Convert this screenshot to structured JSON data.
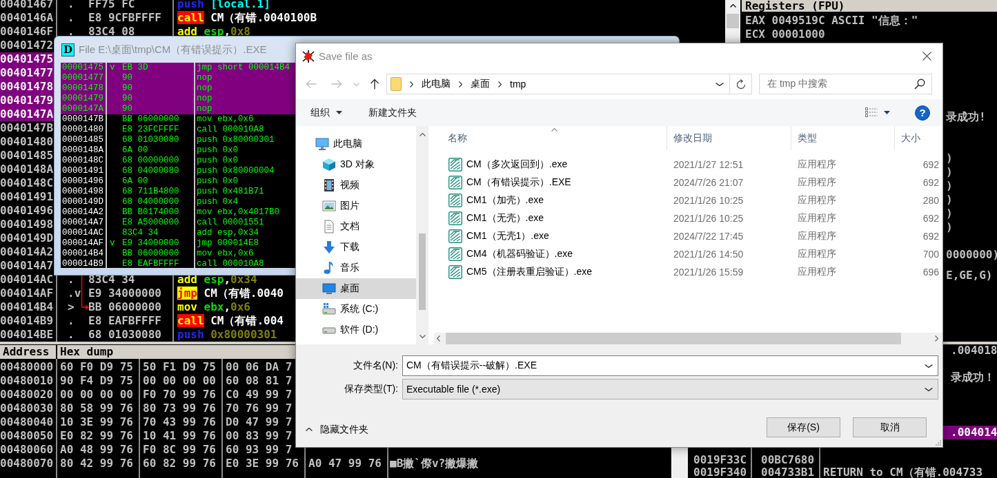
{
  "disassembler": {
    "rows": [
      {
        "address": "00401467",
        "marker": ".",
        "hex": "FF75 FC",
        "mnemonic": {
          "text": "push",
          "kind": "push"
        },
        "operands": [
          {
            "text": "[local.1]",
            "kind": "memory"
          }
        ],
        "selected": false,
        "jump_target": false
      },
      {
        "address": "0040146A",
        "marker": ".",
        "hex": "E8 9CFBFFFF",
        "mnemonic": {
          "text": "call",
          "kind": "call"
        },
        "operands": [
          {
            "text": "CM（有错.0040100B",
            "kind": "label"
          }
        ],
        "selected": false,
        "jump_target": false
      },
      {
        "address": "0040146F",
        "marker": ".",
        "hex": "83C4 08",
        "mnemonic": {
          "text": "add",
          "kind": "plain"
        },
        "operands": [
          {
            "text": "esp",
            "kind": "register"
          },
          {
            "text": ",",
            "kind": "label"
          },
          {
            "text": "0x8",
            "kind": "constant"
          }
        ],
        "selected": false,
        "jump_target": false
      },
      {
        "address": "00401472",
        "selected": false
      },
      {
        "address": "00401475",
        "selected": true
      },
      {
        "address": "00401477",
        "selected": true
      },
      {
        "address": "00401478",
        "selected": true
      },
      {
        "address": "00401479",
        "selected": true
      },
      {
        "address": "0040147A",
        "selected": true
      },
      {
        "address": "0040147B",
        "selected": false
      },
      {
        "address": "00401480",
        "selected": false
      },
      {
        "address": "00401485",
        "selected": false
      },
      {
        "address": "0040148A",
        "selected": false
      },
      {
        "address": "0040148C",
        "selected": false
      },
      {
        "address": "00401491",
        "selected": false
      },
      {
        "address": "00401496",
        "selected": false
      },
      {
        "address": "00401498",
        "selected": false
      },
      {
        "address": "0040149D",
        "selected": false
      },
      {
        "address": "004014A2",
        "selected": false
      },
      {
        "address": "004014A7",
        "selected": false
      },
      {
        "address": "004014AC",
        "marker": ".",
        "hex": "83C4 34",
        "mnemonic": {
          "text": "add",
          "kind": "plain"
        },
        "operands": [
          {
            "text": "esp",
            "kind": "register"
          },
          {
            "text": ",",
            "kind": "label"
          },
          {
            "text": "0x34",
            "kind": "constant"
          }
        ],
        "selected": false,
        "jump_target": false
      },
      {
        "address": "004014AF",
        "marker": ".v",
        "hex": "E9 34000000",
        "mnemonic": {
          "text": "jmp",
          "kind": "jump"
        },
        "operands": [
          {
            "text": "CM（有错.0040",
            "kind": "label"
          }
        ],
        "selected": false,
        "jump_target": false
      },
      {
        "address": "004014B4",
        "marker": ">",
        "hex": "BB 06000000",
        "mnemonic": {
          "text": "mov",
          "kind": "plain"
        },
        "operands": [
          {
            "text": "ebx",
            "kind": "register"
          },
          {
            "text": ",",
            "kind": "label"
          },
          {
            "text": "0x6",
            "kind": "constant"
          }
        ],
        "selected": false,
        "jump_target": true
      },
      {
        "address": "004014B9",
        "marker": ".",
        "hex": "E8 EAFBFFFF",
        "mnemonic": {
          "text": "call",
          "kind": "call"
        },
        "operands": [
          {
            "text": "CM（有错.004",
            "kind": "label"
          }
        ],
        "selected": false,
        "jump_target": false
      },
      {
        "address": "004014BE",
        "marker": ".",
        "hex": "68 01030080",
        "mnemonic": {
          "text": "push",
          "kind": "push"
        },
        "operands": [
          {
            "text": "0x80000301",
            "kind": "constant"
          }
        ],
        "selected": false,
        "jump_target": false
      }
    ]
  },
  "registers": {
    "title": "Registers (FPU)",
    "lines": [
      "EAX 0049519C ASCII \"信息：\"",
      "ECX 00001000"
    ],
    "fragments": [
      "录成功!",
      ")",
      ")",
      ")",
      ")",
      ")",
      ")",
      "0000000)",
      "E,GE,G)"
    ]
  },
  "hex_dump": {
    "columns": [
      "Address",
      "Hex dump"
    ],
    "rows": [
      {
        "address": "00480000",
        "groups": [
          "60 F0 D9 75",
          "50 F1 D9 75",
          "00 06 DA 7"
        ]
      },
      {
        "address": "00480010",
        "groups": [
          "90 F4 D9 75",
          "00 00 00 00",
          "60 08 81 7"
        ]
      },
      {
        "address": "00480020",
        "groups": [
          "00 00 00 00",
          "F0 70 99 76",
          "C0 49 99 7"
        ]
      },
      {
        "address": "00480030",
        "groups": [
          "80 58 99 76",
          "80 73 99 76",
          "70 76 99 7"
        ]
      },
      {
        "address": "00480040",
        "groups": [
          "10 3E 99 76",
          "70 43 99 76",
          "D0 47 99 7"
        ]
      },
      {
        "address": "00480050",
        "groups": [
          "E0 82 99 76",
          "10 41 99 76",
          "00 83 99 7"
        ]
      },
      {
        "address": "00480060",
        "groups": [
          "A0 48 99 76",
          "F0 8C 99 76",
          "60 93 99 7"
        ]
      },
      {
        "address": "00480070",
        "groups": [
          "80 42 99 76",
          "60 82 99 76",
          "E0 3E 99 76",
          "A0 47 99 76"
        ],
        "ascii": "■B撇`傺v?撇爆撇"
      }
    ]
  },
  "stack": {
    "rows": [
      {
        "comment": ".004018",
        "selected": false
      },
      {
        "comment": "录成功！",
        "selected": false
      },
      {
        "comment": ".004014",
        "selected": true
      },
      {
        "address": "0019F33C",
        "value": "00BC7680",
        "selected": false
      },
      {
        "address": "0019F340",
        "value": "004733B1",
        "comment": "RETURN to CM（有错.004733",
        "selected": false
      }
    ]
  },
  "file_window": {
    "badge": "D",
    "title": "File E:\\桌面\\tmp\\CM（有错误提示）.EXE",
    "rows": [
      {
        "address": "00001475",
        "marker": "v",
        "hex": "EB 3D",
        "instruction": "jmp short 000014B4",
        "selected": true
      },
      {
        "address": "00001477",
        "hex": "90",
        "instruction": "nop",
        "selected": true
      },
      {
        "address": "00001478",
        "hex": "90",
        "instruction": "nop",
        "selected": true
      },
      {
        "address": "00001479",
        "hex": "90",
        "instruction": "nop",
        "selected": true
      },
      {
        "address": "0000147A",
        "hex": "90",
        "instruction": "nop",
        "selected": true
      },
      {
        "address": "0000147B",
        "hex": "BB 06000000",
        "instruction": "mov ebx,0x6",
        "selected": false
      },
      {
        "address": "00001480",
        "hex": "E8 23FCFFFF",
        "instruction": "call 000010A8",
        "selected": false
      },
      {
        "address": "00001485",
        "hex": "68 01030080",
        "instruction": "push 0x80000301",
        "selected": false
      },
      {
        "address": "0000148A",
        "hex": "6A 00",
        "instruction": "push 0x0",
        "selected": false
      },
      {
        "address": "0000148C",
        "hex": "68 00000000",
        "instruction": "push 0x0",
        "selected": false
      },
      {
        "address": "00001491",
        "hex": "68 04000080",
        "instruction": "push 0x80000004",
        "selected": false
      },
      {
        "address": "00001496",
        "hex": "6A 00",
        "instruction": "push 0x0",
        "selected": false
      },
      {
        "address": "00001498",
        "hex": "68 711B4800",
        "instruction": "push 0x481B71",
        "selected": false
      },
      {
        "address": "0000149D",
        "hex": "68 04000000",
        "instruction": "push 0x4",
        "selected": false
      },
      {
        "address": "000014A2",
        "hex": "BB B0174000",
        "instruction": "mov ebx,0x4017B0",
        "selected": false
      },
      {
        "address": "000014A7",
        "hex": "E8 A5000000",
        "instruction": "call 00001551",
        "selected": false
      },
      {
        "address": "000014AC",
        "hex": "83C4 34",
        "instruction": "add esp,0x34",
        "selected": false
      },
      {
        "address": "000014AF",
        "marker": "v",
        "hex": "E9 34000000",
        "instruction": "jmp 000014E8",
        "selected": false
      },
      {
        "address": "000014B4",
        "hex": "BB 06000000",
        "instruction": "mov ebx,0x6",
        "selected": false
      },
      {
        "address": "000014B9",
        "hex": "E8 EAFBFFFF",
        "instruction": "call 000010A8",
        "selected": false
      }
    ]
  },
  "save_dialog": {
    "title": "Save file as",
    "breadcrumb": [
      "此电脑",
      "桌面",
      "tmp"
    ],
    "search": {
      "placeholder": "在 tmp 中搜索"
    },
    "toolbar": {
      "organize": "组织",
      "new_folder": "新建文件夹",
      "help": "?"
    },
    "nav": [
      {
        "label": "此电脑",
        "kind": "computer",
        "selected": false,
        "children": [
          {
            "label": "3D 对象",
            "kind": "cube",
            "selected": false
          },
          {
            "label": "视频",
            "kind": "video",
            "selected": false
          },
          {
            "label": "图片",
            "kind": "picture",
            "selected": false
          },
          {
            "label": "文档",
            "kind": "document",
            "selected": false
          },
          {
            "label": "下载",
            "kind": "download",
            "selected": false
          },
          {
            "label": "音乐",
            "kind": "music",
            "selected": false
          },
          {
            "label": "桌面",
            "kind": "desktop",
            "selected": true
          },
          {
            "label": "系统 (C:)",
            "kind": "system_drive",
            "selected": false
          },
          {
            "label": "软件 (D:)",
            "kind": "drive",
            "selected": false
          }
        ]
      }
    ],
    "columns": [
      {
        "label": "名称",
        "sorted": true
      },
      {
        "label": "修改日期",
        "sorted": false
      },
      {
        "label": "类型",
        "sorted": false
      },
      {
        "label": "大小",
        "sorted": false
      }
    ],
    "files": [
      {
        "name": "CM（多次返回到）.exe",
        "modified": "2021/1/27 12:51",
        "type": "应用程序",
        "size": "692"
      },
      {
        "name": "CM（有错误提示）.EXE",
        "modified": "2024/7/26 21:07",
        "type": "应用程序",
        "size": "692"
      },
      {
        "name": "CM1（加壳）.exe",
        "modified": "2021/1/26 10:25",
        "type": "应用程序",
        "size": "280"
      },
      {
        "name": "CM1（无壳）.exe",
        "modified": "2021/1/26 10:25",
        "type": "应用程序",
        "size": "692"
      },
      {
        "name": "CM1（无壳1）.exe",
        "modified": "2024/7/22 17:45",
        "type": "应用程序",
        "size": "692"
      },
      {
        "name": "CM4（机器码验证）.exe",
        "modified": "2021/1/26 14:50",
        "type": "应用程序",
        "size": "700"
      },
      {
        "name": "CM5（注册表重启验证）.exe",
        "modified": "2021/1/26 15:59",
        "type": "应用程序",
        "size": "696"
      }
    ],
    "file_name": {
      "label": "文件名(N):",
      "value": "CM（有错误提示--破解）.EXE"
    },
    "file_type": {
      "label": "保存类型(T):",
      "value": "Executable file (*.exe)"
    },
    "hide_folders": "隐藏文件夹",
    "buttons": [
      "保存(S)",
      "取消"
    ]
  }
}
